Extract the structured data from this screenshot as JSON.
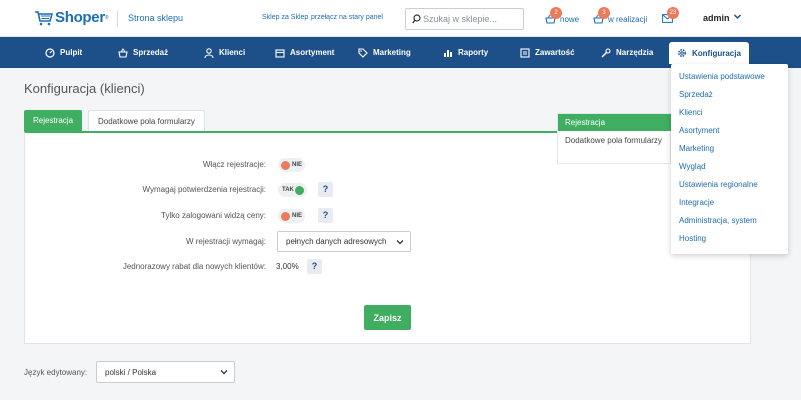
{
  "header": {
    "logo_text": "Shoper",
    "logo_sup": "®",
    "store_link": "Strona sklepu",
    "storefront_link": "Sklep za Sklep",
    "oldpanel_link": "przełącz na stary panel",
    "search_placeholder": "Szukaj w sklepie...",
    "notifications": [
      {
        "label": "nowe",
        "count": "2",
        "icon": "basket-icon"
      },
      {
        "label": "w realizacji",
        "count": "3",
        "icon": "basket-icon"
      },
      {
        "label": "",
        "count": "23",
        "icon": "mail-icon"
      }
    ],
    "user": "admin"
  },
  "nav": [
    {
      "label": "Pulpit",
      "icon": "dashboard-icon"
    },
    {
      "label": "Sprzedaż",
      "icon": "basket-icon"
    },
    {
      "label": "Klienci",
      "icon": "user-icon"
    },
    {
      "label": "Asortyment",
      "icon": "box-icon"
    },
    {
      "label": "Marketing",
      "icon": "tag-icon"
    },
    {
      "label": "Raporty",
      "icon": "chart-icon"
    },
    {
      "label": "Zawartość",
      "icon": "content-icon"
    },
    {
      "label": "Narzędzia",
      "icon": "tools-icon"
    },
    {
      "label": "Konfiguracja",
      "icon": "gear-icon"
    }
  ],
  "config_menu": [
    "Ustawienia podstawowe",
    "Sprzedaż",
    "Klienci",
    "Asortyment",
    "Marketing",
    "Wygląd",
    "Ustawienia regionalne",
    "Integracje",
    "Administracja, system",
    "Hosting"
  ],
  "page": {
    "title": "Konfiguracja (klienci)",
    "tabs": [
      "Rejestracja",
      "Dodatkowe pola formularzy"
    ],
    "side_menu": [
      "Rejestracja",
      "Dodatkowe pola formularzy"
    ],
    "fields": {
      "enable_registration": {
        "label": "Włącz rejestracje:",
        "value": "NIE"
      },
      "require_confirmation": {
        "label": "Wymagaj potwierdzenia rejestracji:",
        "value": "TAK"
      },
      "prices_logged_only": {
        "label": "Tylko zalogowani widzą ceny:",
        "value": "NIE"
      },
      "registration_requires": {
        "label": "W rejestracji wymagaj:",
        "value": "pełnych danych adresowych"
      },
      "one_time_discount": {
        "label": "Jednorazowy rabat dla nowych klientów:",
        "value": "3,00%"
      }
    },
    "help_symbol": "?",
    "save_label": "Zapisz",
    "language": {
      "label": "Język edytowany:",
      "value": "polski / Polska"
    }
  },
  "colors": {
    "nav_bg": "#1d4f88",
    "accent_green": "#3fae60",
    "toggle_off": "#ed7a5b",
    "toggle_on": "#3fae60",
    "badge": "#ed7a5b",
    "link_blue": "#1d6db2"
  }
}
